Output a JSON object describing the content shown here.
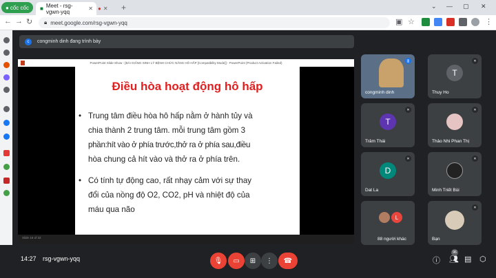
{
  "browser": {
    "home_label": "cốc cốc",
    "tab_title": "Meet - rsg-vgwn-yqq",
    "url": "meet.google.com/rsg-vgwn-yqq"
  },
  "banner": {
    "presenter_text": "congminh dinh đang trình bày"
  },
  "ppt": {
    "window_title": "PowerPoint Slide Show - [BÀI GIẢNG SINH LÝ BỆNH CHỨC NĂNG HÔ HẤP [Compatibility Mode]] - PowerPoint (Product Activation Failed)",
    "slide_status": "Slide 16 of 32",
    "slide_title": "Điều hòa hoạt động hô hấp",
    "bullet1": {
      "lines": [
        "Trung tâm điều hòa hô hấp nằm ở hành tủy và",
        "chia thành 2 trung tâm. mỗi trung tâm gồm 3",
        "phần:hít vào ở phía trước,thở ra ở phía sau,điều",
        "hòa chung cả hít vào và thở ra ở phía trên."
      ]
    },
    "bullet2": {
      "lines": [
        "Có tính tự động cao, rất nhạy cảm với sự thay",
        "đổi của nồng độ O2, CO2, pH và nhiệt độ của",
        "máu qua não"
      ]
    }
  },
  "participants": [
    {
      "name": "congminh dinh",
      "initial": "",
      "color": "#c9a26b"
    },
    {
      "name": "Thuy Ho",
      "initial": "T",
      "color": "#5f6368"
    },
    {
      "name": "Trâm Thái",
      "initial": "T",
      "color": "#5e35b1"
    },
    {
      "name": "Thảo Nhi Phan Thị",
      "initial": "",
      "color": "#e7c4c4"
    },
    {
      "name": "Dat La",
      "initial": "D",
      "color": "#00897b"
    },
    {
      "name": "Minh Triết Bùi",
      "initial": "",
      "color": "#222222"
    },
    {
      "name": "88 người khác",
      "initial": "L",
      "color": "#e8453c"
    },
    {
      "name": "Bạn",
      "initial": "",
      "color": "#d8cbb8"
    }
  ],
  "bottom": {
    "time": "14:27",
    "code": "rsg-vgwn-yqq",
    "people_count": "96"
  },
  "colors": {
    "end_call": "#ea4335",
    "muted_red": "#ea4335",
    "brand_green": "#2e9e4f"
  }
}
